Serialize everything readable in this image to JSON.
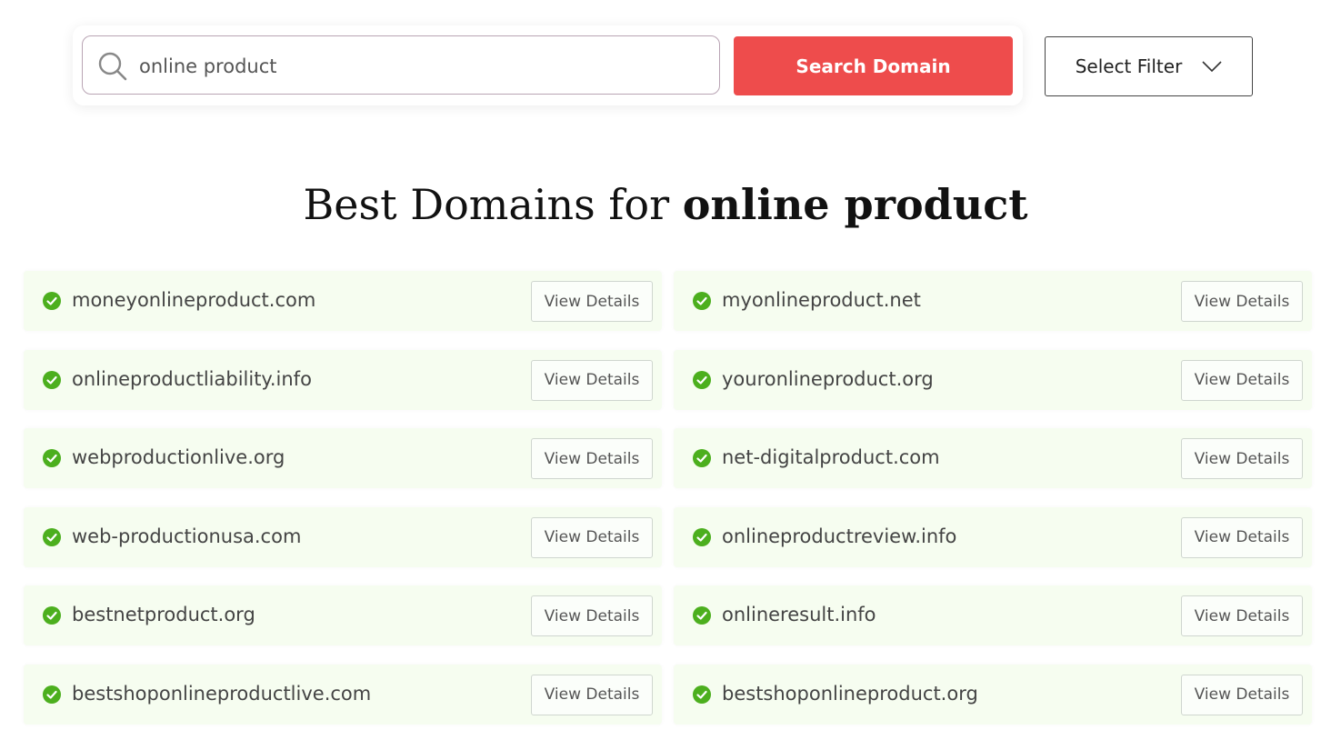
{
  "search": {
    "value": "online product",
    "button_label": "Search Domain",
    "filter_label": "Select Filter"
  },
  "heading": {
    "prefix": "Best Domains for ",
    "query": "online product"
  },
  "results": [
    {
      "domain": "moneyonlineproduct.com",
      "action": "View Details"
    },
    {
      "domain": "myonlineproduct.net",
      "action": "View Details"
    },
    {
      "domain": "onlineproductliability.info",
      "action": "View Details"
    },
    {
      "domain": "youronlineproduct.org",
      "action": "View Details"
    },
    {
      "domain": "webproductionlive.org",
      "action": "View Details"
    },
    {
      "domain": "net-digitalproduct.com",
      "action": "View Details"
    },
    {
      "domain": "web-productionusa.com",
      "action": "View Details"
    },
    {
      "domain": "onlineproductreview.info",
      "action": "View Details"
    },
    {
      "domain": "bestnetproduct.org",
      "action": "View Details"
    },
    {
      "domain": "onlineresult.info",
      "action": "View Details"
    },
    {
      "domain": "bestshoponlineproductlive.com",
      "action": "View Details"
    },
    {
      "domain": "bestshoponlineproduct.org",
      "action": "View Details"
    }
  ],
  "colors": {
    "accent": "#ee4c4c",
    "check": "#4caf1e",
    "row_bg": "#f6fdf0"
  },
  "icons": {
    "search": "search-icon",
    "check": "check-circle-icon",
    "dropdown": "chevron-down-icon"
  }
}
